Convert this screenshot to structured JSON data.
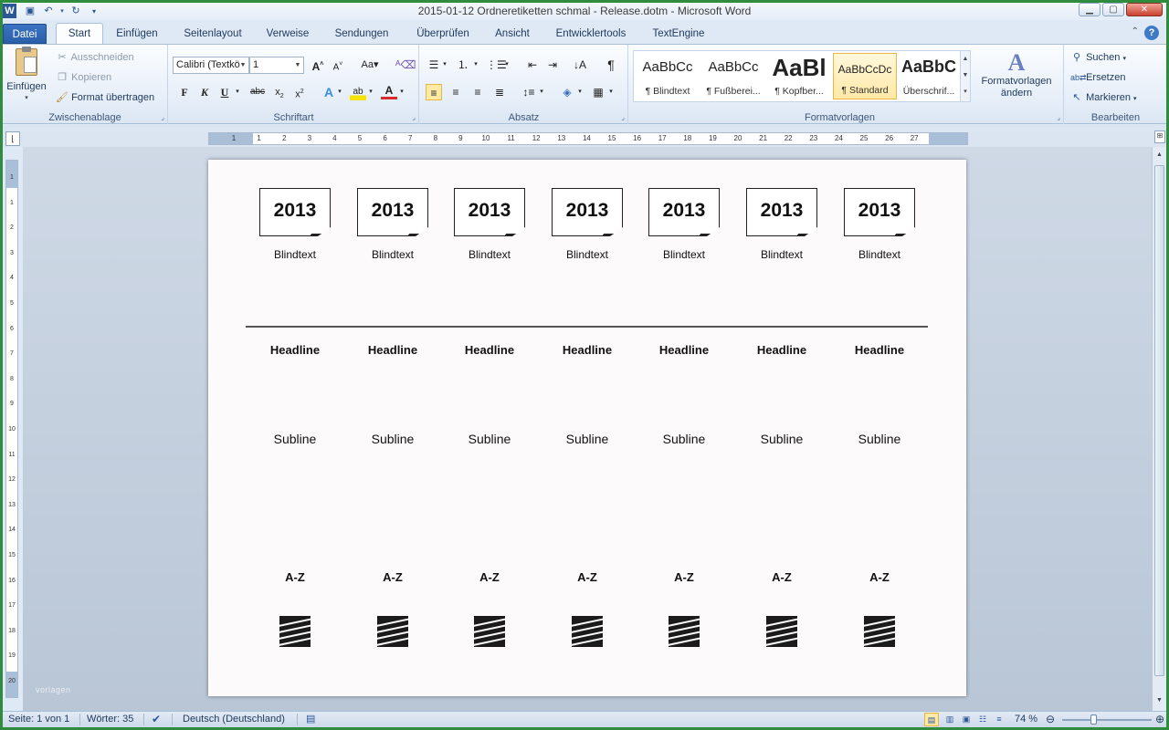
{
  "window": {
    "title": "2015-01-12 Ordneretiketten schmal - Release.dotm  -  Microsoft Word",
    "app_icon": "W"
  },
  "quick_access": [
    "save-icon",
    "undo-icon",
    "redo-icon",
    "customize-icon"
  ],
  "tabs": [
    {
      "label": "Datei"
    },
    {
      "label": "Start"
    },
    {
      "label": "Einfügen"
    },
    {
      "label": "Seitenlayout"
    },
    {
      "label": "Verweise"
    },
    {
      "label": "Sendungen"
    },
    {
      "label": "Überprüfen"
    },
    {
      "label": "Ansicht"
    },
    {
      "label": "Entwicklertools"
    },
    {
      "label": "TextEngine"
    }
  ],
  "ribbon": {
    "clipboard": {
      "label": "Zwischenablage",
      "paste": "Einfügen",
      "cut": "Ausschneiden",
      "copy": "Kopieren",
      "format_painter": "Format übertragen"
    },
    "font": {
      "label": "Schriftart",
      "font_name": "Calibri (Textkö",
      "font_size": "1"
    },
    "paragraph": {
      "label": "Absatz"
    },
    "styles": {
      "label": "Formatvorlagen",
      "items": [
        {
          "sample": "AaBbCc",
          "name": "¶ Blindtext"
        },
        {
          "sample": "AaBbCc",
          "name": "¶ Fußberei..."
        },
        {
          "sample": "AaBl",
          "name": "¶ Kopfber..."
        },
        {
          "sample": "AaBbCcDc",
          "name": "¶ Standard"
        },
        {
          "sample": "AaBbC",
          "name": "Überschrif..."
        }
      ],
      "change_styles": "Formatvorlagen ändern"
    },
    "editing": {
      "label": "Bearbeiten",
      "find": "Suchen",
      "replace": "Ersetzen",
      "select": "Markieren"
    }
  },
  "hruler_labels": [
    "1",
    "1",
    "2",
    "3",
    "4",
    "5",
    "6",
    "7",
    "8",
    "9",
    "10",
    "11",
    "12",
    "13",
    "14",
    "15",
    "16",
    "17",
    "18",
    "19",
    "20",
    "21",
    "22",
    "23",
    "24",
    "25",
    "26",
    "27"
  ],
  "vruler_labels": [
    "1",
    "1",
    "2",
    "3",
    "4",
    "5",
    "6",
    "7",
    "8",
    "9",
    "10",
    "11",
    "12",
    "13",
    "14",
    "15",
    "16",
    "17",
    "18",
    "19",
    "20"
  ],
  "document": {
    "labels": [
      {
        "year": "2013",
        "blindtext": "Blindtext",
        "headline": "Headline",
        "subline": "Subline",
        "az": "A-Z"
      },
      {
        "year": "2013",
        "blindtext": "Blindtext",
        "headline": "Headline",
        "subline": "Subline",
        "az": "A-Z"
      },
      {
        "year": "2013",
        "blindtext": "Blindtext",
        "headline": "Headline",
        "subline": "Subline",
        "az": "A-Z"
      },
      {
        "year": "2013",
        "blindtext": "Blindtext",
        "headline": "Headline",
        "subline": "Subline",
        "az": "A-Z"
      },
      {
        "year": "2013",
        "blindtext": "Blindtext",
        "headline": "Headline",
        "subline": "Subline",
        "az": "A-Z"
      },
      {
        "year": "2013",
        "blindtext": "Blindtext",
        "headline": "Headline",
        "subline": "Subline",
        "az": "A-Z"
      },
      {
        "year": "2013",
        "blindtext": "Blindtext",
        "headline": "Headline",
        "subline": "Subline",
        "az": "A-Z"
      }
    ]
  },
  "watermark": "vorlagen",
  "statusbar": {
    "page": "Seite: 1 von 1",
    "words": "Wörter: 35",
    "language": "Deutsch (Deutschland)",
    "zoom": "74 %",
    "zoom_level_percent": 74
  },
  "colors": {
    "outer_border": "#2f8c3f",
    "file_tab": "#2a5ea9",
    "selected_style": "#ffe9a6"
  }
}
